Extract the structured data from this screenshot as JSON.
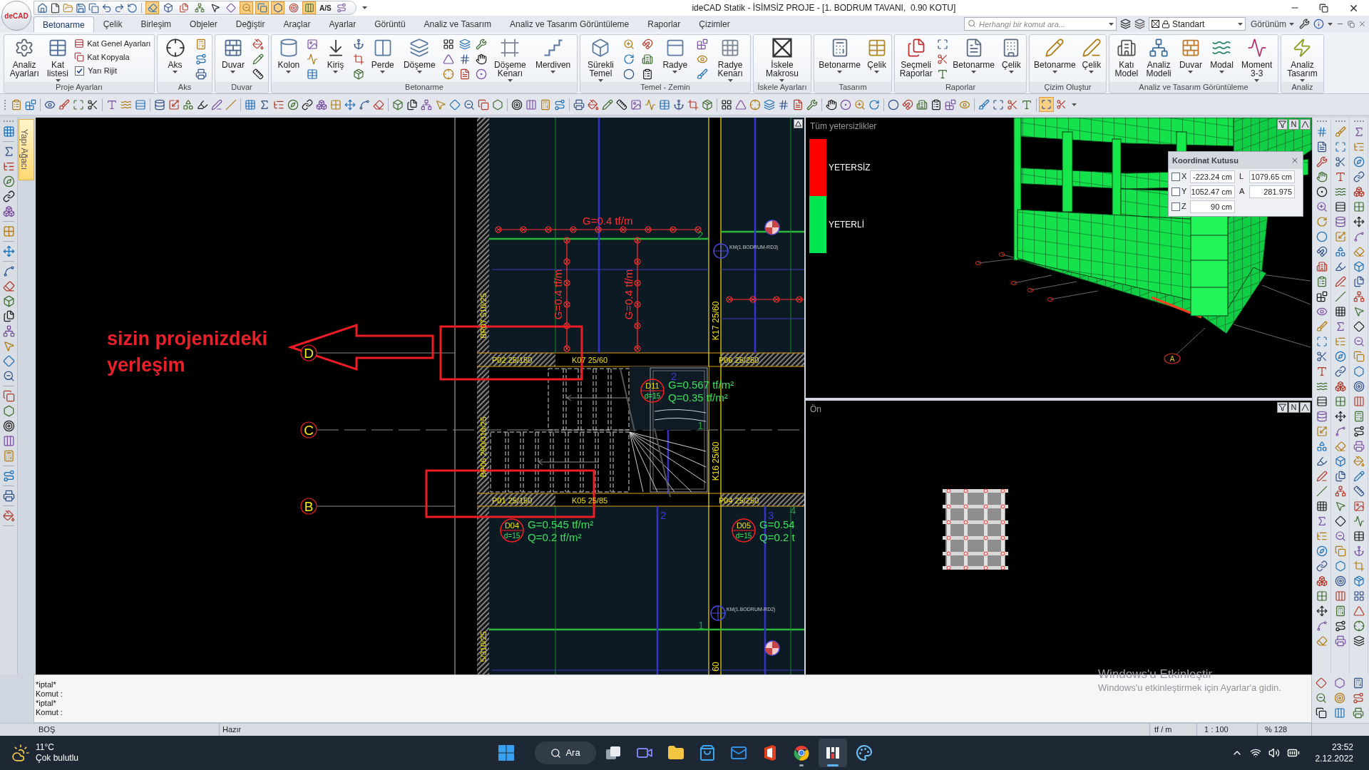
{
  "title_bar": {
    "logo": "deCAD",
    "title": "ideCAD Statik - İSİMSİZ PROJE - [1. BODRUM TAVANI,  0.90 KOTU]"
  },
  "quick_toggles": [
    {
      "pressed": true
    },
    {
      "pressed": false
    },
    {
      "pressed": false
    },
    {
      "pressed": false
    },
    {
      "pressed": false
    },
    {
      "pressed": false
    },
    {
      "pressed": true
    },
    {
      "pressed": true
    },
    {
      "pressed": true
    },
    {
      "pressed": false
    },
    {
      "pressed": true
    },
    {
      "pressed": false,
      "label": "A/S"
    },
    {
      "pressed": false
    }
  ],
  "tabs": [
    {
      "label": "Betonarme",
      "selected": true
    },
    {
      "label": "Çelik",
      "selected": false
    },
    {
      "label": "Birleşim",
      "selected": false
    },
    {
      "label": "Objeler",
      "selected": false
    },
    {
      "label": "Değiştir",
      "selected": false
    },
    {
      "label": "Araçlar",
      "selected": false
    },
    {
      "label": "Ayarlar",
      "selected": false
    },
    {
      "label": "Görüntü",
      "selected": false
    },
    {
      "label": "Analiz ve Tasarım",
      "selected": false
    },
    {
      "label": "Analiz ve Tasarım Görüntüleme",
      "selected": false
    },
    {
      "label": "Raporlar",
      "selected": false
    },
    {
      "label": "Çizimler",
      "selected": false
    }
  ],
  "command_search": {
    "placeholder": "Herhangi bir komut ara..."
  },
  "style_select": {
    "value": "Standart"
  },
  "view_menu": {
    "label": "Görünüm"
  },
  "ribbon": {
    "groups": [
      {
        "label": "Proje Ayarları",
        "items": [
          {
            "kind": "large",
            "label": "Analiz Ayarları",
            "dropdown": false
          },
          {
            "kind": "large",
            "label": "Kat listesi",
            "dropdown": true
          },
          {
            "kind": "stack",
            "rows": [
              {
                "kind": "command",
                "label": "Kat Genel Ayarları"
              },
              {
                "kind": "command",
                "label": "Kat Kopyala"
              },
              {
                "kind": "checkbox",
                "label": "Yarı Rijit",
                "checked": true
              }
            ]
          }
        ]
      },
      {
        "label": "Aks",
        "items": [
          {
            "kind": "large",
            "label": "Aks",
            "dropdown": true
          },
          {
            "kind": "icon_column"
          }
        ]
      },
      {
        "label": "Duvar",
        "items": [
          {
            "kind": "large",
            "label": "Duvar",
            "dropdown": true
          },
          {
            "kind": "icon_column"
          }
        ]
      },
      {
        "label": "Betonarme",
        "items": [
          {
            "kind": "large",
            "label": "Kolon",
            "dropdown": true
          },
          {
            "kind": "icon_column"
          },
          {
            "kind": "large",
            "label": "Kiriş",
            "dropdown": true
          },
          {
            "kind": "icon_column"
          },
          {
            "kind": "large",
            "label": "Perde",
            "dropdown": true
          },
          {
            "kind": "large",
            "label": "Döşeme",
            "dropdown": true
          },
          {
            "kind": "icon_column"
          },
          {
            "kind": "icon_column"
          },
          {
            "kind": "icon_column"
          },
          {
            "kind": "large",
            "label": "Döşeme Kenarı",
            "dropdown": true
          },
          {
            "kind": "large",
            "label": "Merdiven",
            "dropdown": true
          }
        ]
      },
      {
        "label": "Temel - Zemin",
        "items": [
          {
            "kind": "large",
            "label": "Sürekli Temel",
            "dropdown": true
          },
          {
            "kind": "icon_column"
          },
          {
            "kind": "icon_column"
          },
          {
            "kind": "large",
            "label": "Radye",
            "dropdown": true
          },
          {
            "kind": "icon_column"
          },
          {
            "kind": "large",
            "label": "Radye Kenarı",
            "dropdown": true
          }
        ]
      },
      {
        "label": "İskele Ayarları",
        "items": [
          {
            "kind": "large",
            "label": "İskele Makrosu",
            "dropdown": true
          }
        ]
      },
      {
        "label": "Tasarım",
        "items": [
          {
            "kind": "large",
            "label": "Betonarme",
            "dropdown": true
          },
          {
            "kind": "large",
            "label": "Çelik",
            "dropdown": true
          }
        ]
      },
      {
        "label": "Raporlar",
        "items": [
          {
            "kind": "large",
            "label": "Seçmeli Raporlar",
            "dropdown": false
          },
          {
            "kind": "icon_column"
          },
          {
            "kind": "large",
            "label": "Betonarme",
            "dropdown": true
          },
          {
            "kind": "large",
            "label": "Çelik",
            "dropdown": true
          }
        ]
      },
      {
        "label": "Çizim Oluştur",
        "items": [
          {
            "kind": "large",
            "label": "Betonarme",
            "dropdown": true
          },
          {
            "kind": "large",
            "label": "Çelik",
            "dropdown": true
          }
        ]
      },
      {
        "label": "Analiz ve Tasarım Görüntüleme",
        "items": [
          {
            "kind": "large",
            "label": "Katı Model",
            "dropdown": false
          },
          {
            "kind": "large",
            "label": "Analiz Modeli",
            "dropdown": false
          },
          {
            "kind": "large",
            "label": "Duvar",
            "dropdown": true
          },
          {
            "kind": "large",
            "label": "Modal",
            "dropdown": true
          },
          {
            "kind": "large",
            "label": "Moment 3-3",
            "dropdown": true
          }
        ]
      },
      {
        "label": "Analiz",
        "items": [
          {
            "kind": "large",
            "label": "Analiz Tasarım",
            "dropdown": true
          }
        ]
      }
    ]
  },
  "toolbar_toggles": [
    {
      "pressed": true
    },
    {
      "pressed": false
    }
  ],
  "side_tab": {
    "label": "Yapı Ağacı"
  },
  "plan_view": {
    "annotation": {
      "lines": [
        "sizin projenizdeki",
        "yerleşim"
      ]
    },
    "axes": [
      "D",
      "C",
      "B"
    ],
    "band_labels": [
      "P02 25/150",
      "K07 25/60",
      "P06 25/250",
      "P01 25/150",
      "K05 25/85",
      "P04 25/250"
    ],
    "wall_labels": [
      "BP07 510/25",
      "BP06 290/310/25",
      "5/310/25"
    ],
    "column_labels": [
      "K17 25/60",
      "K16 25/60",
      "60"
    ],
    "line_loads": [
      "G=0.4 tf/m",
      "G=0.4 tf/m",
      "G=0.4 tf/m"
    ],
    "slabs": [
      {
        "id": "D11",
        "thickness": "d=15",
        "dead_load": "G=0.567 tf/m²",
        "live_load": "Q=0.35 tf/m²"
      },
      {
        "id": "D04",
        "thickness": "d=15",
        "dead_load": "G=0.545 tf/m²",
        "live_load": "Q=0.2 tf/m²"
      },
      {
        "id": "D05",
        "thickness": "d=15",
        "dead_load": "G=0.54",
        "live_load": "Q=0.2 t"
      }
    ],
    "markers": [
      "KM(1.BODRUM-RD3)",
      "KM(1.BODRUM-RD2)"
    ],
    "span_numbers": [
      {
        "label": "2",
        "color": "#1e9e3c"
      },
      {
        "label": "2",
        "color": "#3c3cdc"
      },
      {
        "label": "1",
        "color": "#1e9e3c"
      },
      {
        "label": "4",
        "color": "#1e9e3c"
      },
      {
        "label": "2",
        "color": "#3c3cdc"
      },
      {
        "label": "3",
        "color": "#3c3cdc"
      },
      {
        "label": "1",
        "color": "#1e9e3c"
      }
    ]
  },
  "analysis_view": {
    "title": "Tüm yetersizlikler",
    "legend": [
      {
        "label": "YETERSİZ",
        "color": "#ff0000"
      },
      {
        "label": "YETERLİ",
        "color": "#00e650"
      }
    ],
    "axis_label": "A",
    "button_label": "N"
  },
  "coordinate_box": {
    "title": "Koordinat Kutusu",
    "rows": [
      {
        "axis": "X",
        "checked": false,
        "value": "-223.24 cm",
        "label": "L",
        "reading": "1079.65 cm"
      },
      {
        "axis": "Y",
        "checked": false,
        "value": "1052.47 cm",
        "label": "A",
        "reading": "281.975"
      },
      {
        "axis": "Z",
        "checked": false,
        "value": "90 cm"
      }
    ]
  },
  "front_view": {
    "title": "Ön",
    "button_label": "N"
  },
  "command_log": [
    "*iptal*",
    "Komut :",
    "*iptal*",
    "Komut :"
  ],
  "status_bar": {
    "mode": "BOŞ",
    "message": "Hazır",
    "unit": "tf / m",
    "scale": "1 : 100",
    "zoom": "% 128"
  },
  "activation_notice": {
    "title": "Windows'u Etkinleştir",
    "text": "Windows'u etkinleştirmek için Ayarlar'a gidin."
  },
  "taskbar": {
    "weather": {
      "temperature": "11°C",
      "condition": "Çok bulutlu"
    },
    "search": "Ara",
    "apps": [
      {
        "kind": "taskview",
        "running": false,
        "active": false
      },
      {
        "kind": "chat",
        "running": false,
        "active": false
      },
      {
        "kind": "files",
        "running": false,
        "active": false
      },
      {
        "kind": "store",
        "running": false,
        "active": false
      },
      {
        "kind": "mail",
        "running": false,
        "active": false
      },
      {
        "kind": "office",
        "running": false,
        "active": false
      },
      {
        "kind": "browser",
        "running": true,
        "active": false
      },
      {
        "kind": "cad",
        "running": true,
        "active": true
      },
      {
        "kind": "paint",
        "running": false,
        "active": false
      }
    ],
    "clock": {
      "time": "23:52",
      "date": "2.12.2022"
    }
  }
}
